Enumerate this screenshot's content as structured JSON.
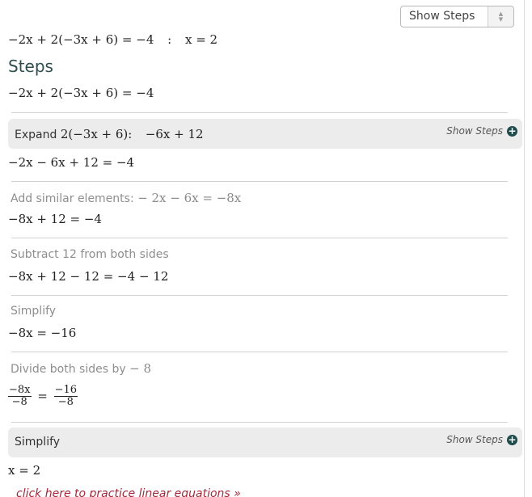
{
  "toolbar": {
    "select_label": "Show Steps"
  },
  "answer": {
    "equation": "−2x + 2(−3x + 6) = −4",
    "separator": ":",
    "solution": "x = 2"
  },
  "steps_title": "Steps",
  "original_equation": "−2x + 2(−3x + 6) = −4",
  "steps": [
    {
      "type": "box",
      "label": "Expand",
      "label_math": "2(−3x + 6):",
      "result_math": "−6x + 12",
      "show_steps": "Show Steps",
      "equation": "−2x − 6x + 12 = −4"
    },
    {
      "type": "plain",
      "label": "Add similar elements:",
      "label_math": "− 2x − 6x = −8x",
      "equation": "−8x + 12 = −4"
    },
    {
      "type": "plain",
      "label": "Subtract 12 from both sides",
      "equation": "−8x + 12 − 12 = −4 − 12"
    },
    {
      "type": "plain",
      "label": "Simplify",
      "equation": "−8x = −16"
    },
    {
      "type": "plain",
      "label": "Divide both sides by",
      "label_math": "− 8",
      "fraction_left": {
        "num": "−8x",
        "den": "−8"
      },
      "equals": "=",
      "fraction_right": {
        "num": "−16",
        "den": "−8"
      }
    },
    {
      "type": "box",
      "label": "Simplify",
      "show_steps": "Show Steps",
      "equation": "x = 2"
    }
  ],
  "practice_link": "click here to practice linear equations »",
  "icons": {
    "plus": "+",
    "arrow_up": "▲",
    "arrow_down": "▼"
  }
}
